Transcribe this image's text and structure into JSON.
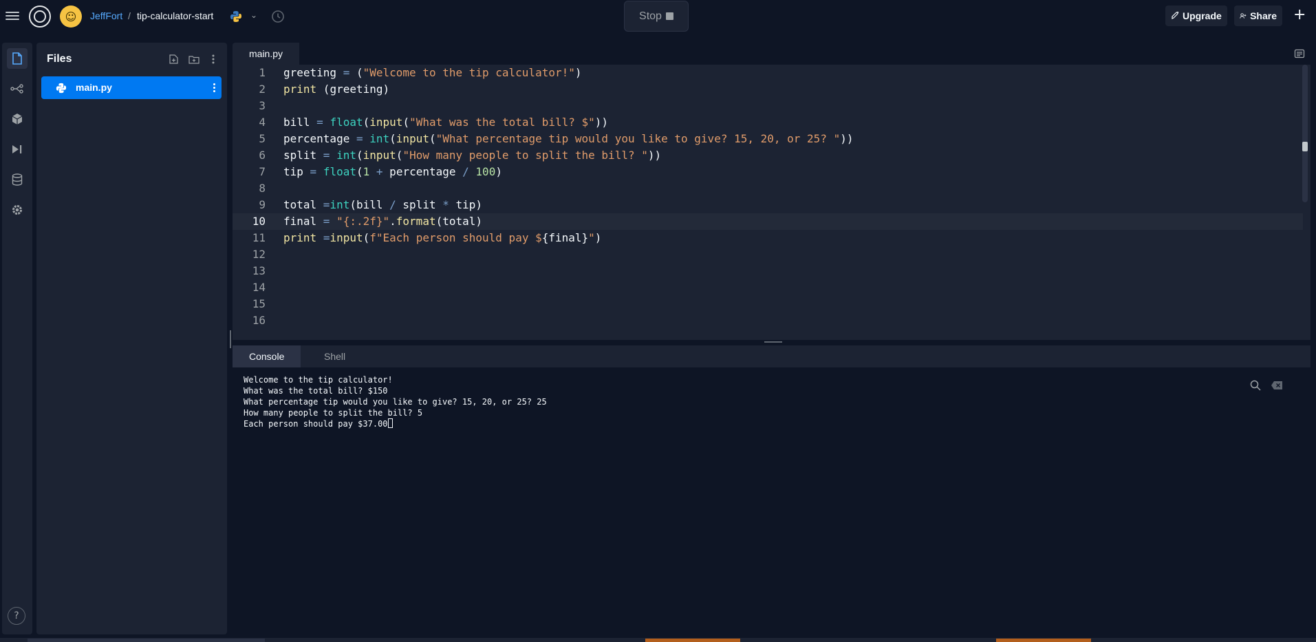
{
  "header": {
    "owner": "JeffFort",
    "separator": "/",
    "repl_name": "tip-calculator-start",
    "run_button_label": "Stop",
    "upgrade_label": "Upgrade",
    "share_label": "Share",
    "plus_label": "+"
  },
  "sidebar": {
    "help_label": "?"
  },
  "files": {
    "title": "Files",
    "items": [
      {
        "name": "main.py",
        "selected": true
      }
    ]
  },
  "editor": {
    "active_tab": "main.py",
    "current_line": 10,
    "lines": [
      {
        "n": "1",
        "text": "greeting = (\"Welcome to the tip calculator!\")"
      },
      {
        "n": "2",
        "text": "print (greeting)"
      },
      {
        "n": "3",
        "text": ""
      },
      {
        "n": "4",
        "text": "bill = float(input(\"What was the total bill? $\"))"
      },
      {
        "n": "5",
        "text": "percentage = int(input(\"What percentage tip would you like to give? 15, 20, or 25? \"))"
      },
      {
        "n": "6",
        "text": "split = int(input(\"How many people to split the bill? \"))"
      },
      {
        "n": "7",
        "text": "tip = float(1 + percentage / 100)"
      },
      {
        "n": "8",
        "text": ""
      },
      {
        "n": "9",
        "text": "total =int(bill / split * tip)"
      },
      {
        "n": "10",
        "text": "final = \"{:.2f}\".format(total)"
      },
      {
        "n": "11",
        "text": "print =input(f\"Each person should pay ${final}\")"
      },
      {
        "n": "12",
        "text": ""
      },
      {
        "n": "13",
        "text": ""
      },
      {
        "n": "14",
        "text": ""
      },
      {
        "n": "15",
        "text": ""
      },
      {
        "n": "16",
        "text": ""
      }
    ]
  },
  "console": {
    "tabs": [
      "Console",
      "Shell"
    ],
    "active_tab": "Console",
    "output": [
      "Welcome to the tip calculator!",
      "What was the total bill? $150",
      "What percentage tip would you like to give? 15, 20, or 25? 25",
      "How many people to split the bill? 5",
      "Each person should pay $37.00"
    ]
  },
  "colors": {
    "accent": "#0079f2",
    "background": "#0e1525",
    "surface": "#1c2333",
    "owner_link": "#57abff",
    "avatar": "#f6c343"
  }
}
